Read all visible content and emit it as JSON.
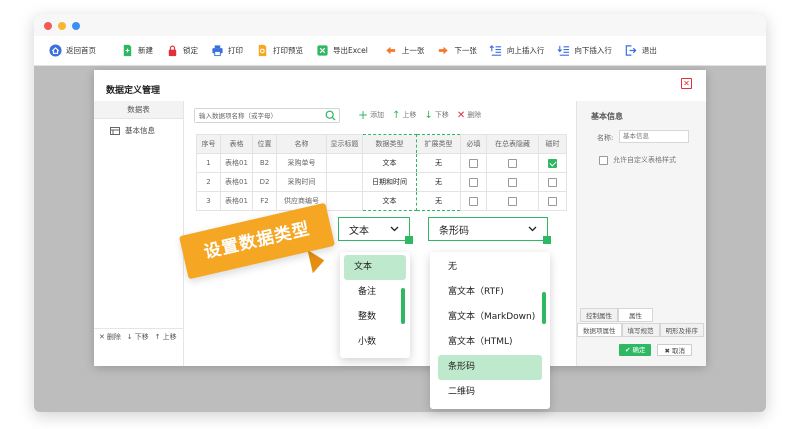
{
  "toolbar": {
    "items": [
      {
        "label": "返回首页",
        "icon": "home-icon",
        "color": "#3a6fe0"
      },
      {
        "label": "新建",
        "icon": "new-file-icon",
        "color": "#2eb862"
      },
      {
        "label": "锁定",
        "icon": "lock-icon",
        "color": "#e0303b"
      },
      {
        "label": "打印",
        "icon": "printer-icon",
        "color": "#3a6fe0"
      },
      {
        "label": "打印预览",
        "icon": "print-preview-icon",
        "color": "#f5a623"
      },
      {
        "label": "导出Excel",
        "icon": "excel-icon",
        "color": "#2eb862"
      },
      {
        "label": "上一张",
        "icon": "prev-icon",
        "color": "#f5782a"
      },
      {
        "label": "下一张",
        "icon": "next-icon",
        "color": "#f5782a"
      },
      {
        "label": "向上插入行",
        "icon": "insert-row-above-icon",
        "color": "#3a6fe0"
      },
      {
        "label": "向下插入行",
        "icon": "insert-row-below-icon",
        "color": "#3a6fe0"
      },
      {
        "label": "退出",
        "icon": "exit-icon",
        "color": "#3a6fe0"
      }
    ]
  },
  "dialog": {
    "title": "数据定义管理",
    "left_header": "数据表",
    "tree_item": "基本信息",
    "left_footer": {
      "delete": "删除",
      "down": "下移",
      "up": "上移"
    },
    "search_placeholder": "输入数据项名称（或字母）",
    "actions": {
      "add": "添加",
      "up": "上移",
      "down": "下移",
      "delete": "删除"
    },
    "columns": [
      "序号",
      "表格",
      "位置",
      "名称",
      "显示标题",
      "数据类型",
      "扩展类型",
      "必填",
      "在总表隐藏",
      "磁时"
    ],
    "rows": [
      {
        "no": "1",
        "table": "表格01",
        "pos": "B2",
        "name": "采购单号",
        "title": "",
        "dtype": "文本",
        "ext": "无",
        "required": false,
        "hidden": false,
        "flag": true
      },
      {
        "no": "2",
        "table": "表格01",
        "pos": "D2",
        "name": "采购时间",
        "title": "",
        "dtype": "日期和时间",
        "ext": "无",
        "required": false,
        "hidden": false,
        "flag": false
      },
      {
        "no": "3",
        "table": "表格01",
        "pos": "F2",
        "name": "供应商编号",
        "title": "",
        "dtype": "文本",
        "ext": "无",
        "required": false,
        "hidden": false,
        "flag": false
      }
    ],
    "right": {
      "title": "基本信息",
      "name_label": "名称:",
      "name_value": "基本信息",
      "checkbox_label": "允许自定义表格样式",
      "tabs_row1": [
        "控制属性",
        "属性"
      ],
      "tabs_row2": [
        "数据项属性",
        "填写规范",
        "明形及排序"
      ]
    },
    "ok": "✔ 确定",
    "cancel": "✖ 取消"
  },
  "dtype_select": {
    "value": "文本",
    "options": [
      "文本",
      "备注",
      "整数",
      "小数"
    ],
    "selected": "文本"
  },
  "ext_select": {
    "value": "条形码",
    "options": [
      "无",
      "富文本（RTF)",
      "富文本（MarkDown)",
      "富文本（HTML)",
      "条形码",
      "二维码"
    ],
    "selected": "条形码"
  },
  "banner": "设置数据类型",
  "colors": {
    "accent": "#2eb862",
    "banner": "#f5a623",
    "close": "#e0303b"
  }
}
